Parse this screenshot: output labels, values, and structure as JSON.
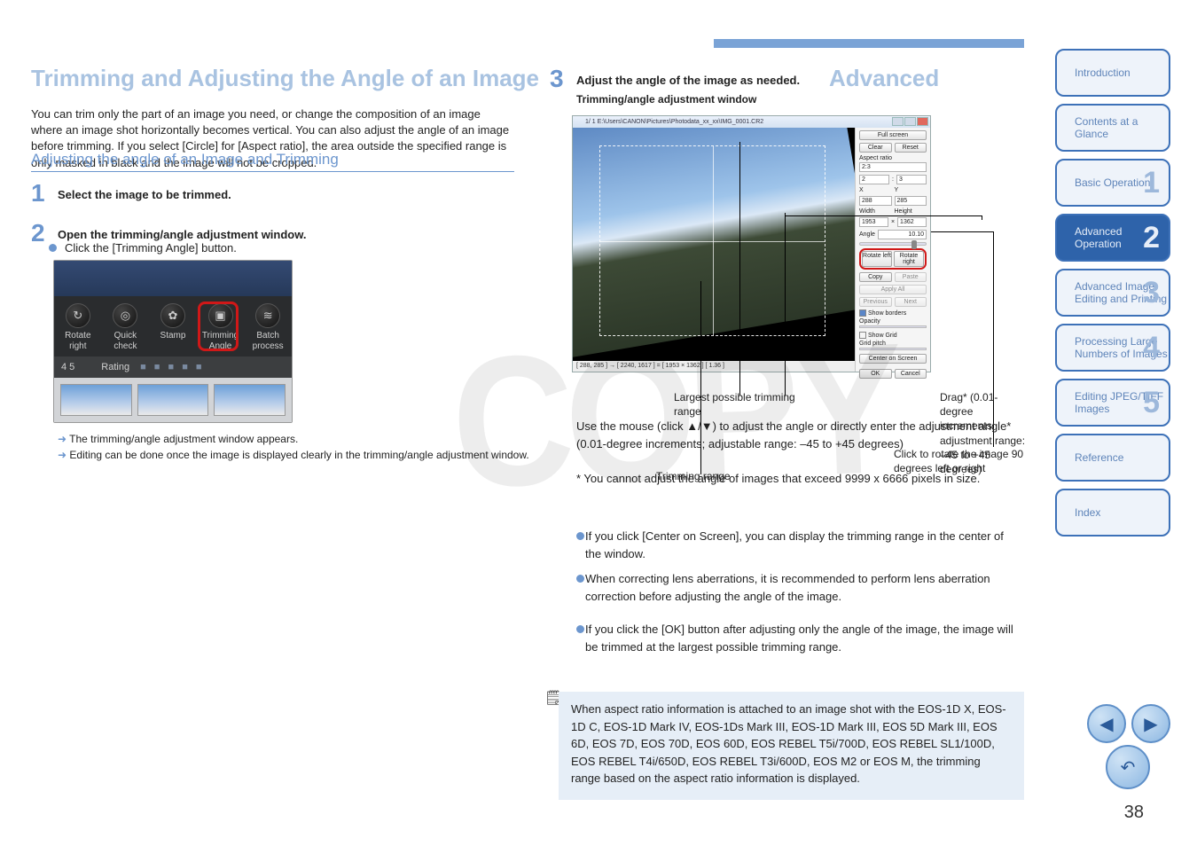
{
  "page": {
    "number": "38",
    "watermark": "COPY",
    "title_main": "Trimming and Adjusting the Angle of an Image",
    "title_sub": "Advanced"
  },
  "top_header": {
    "bar_color": "#7aa3d6"
  },
  "intro": "You can trim only the part of an image you need, or change the composition of an image where an image shot horizontally becomes vertical. You can also adjust the angle of an image before trimming. If you select [Circle] for [Aspect ratio], the area outside the specified range is only masked in black and the image will not be cropped.",
  "section_head": "Adjusting the angle of an Image and Trimming",
  "steps": {
    "s1": {
      "num": "1",
      "text": "Select the image to be trimmed."
    },
    "s2": {
      "num": "2",
      "text": "Open the trimming/angle adjustment window.",
      "bullet": "Click the [Trimming Angle] button."
    },
    "s3": {
      "num": "3",
      "text": "Adjust the angle of the image as needed."
    }
  },
  "toolbar": {
    "buttons": [
      "Rotate right",
      "Quick check",
      "Stamp",
      "Trimming Angle",
      "Batch process"
    ],
    "rating_label": "4 5",
    "rating_text": "Rating"
  },
  "arrows": {
    "a1": "The trimming/angle adjustment window appears.",
    "a2": "Editing can be done once the image is displayed clearly in the trimming/angle adjustment window."
  },
  "app": {
    "title": "1/ 1 E:\\Users\\CANON\\Pictures\\Photodata_xx_xx\\IMG_0001.CR2",
    "status": "[ 288, 285 ] → [ 2240, 1617 ] = [ 1953 × 1362 ] [ 1.36 ]",
    "panel": {
      "full_screen": "Full screen",
      "clear": "Clear",
      "reset": "Reset",
      "aspect_label": "Aspect ratio",
      "aspect_value": "2:3",
      "ratio_a": "2",
      "ratio_b": "3",
      "xy_x": "X",
      "xy_y": "Y",
      "x_val": "288",
      "y_val": "285",
      "w_lbl": "Width",
      "h_lbl": "Height",
      "w_val": "1953",
      "h_val": "1362",
      "angle_lbl": "Angle",
      "angle_val": "10.10",
      "rot_l": "Rotate left",
      "rot_r": "Rotate right",
      "copy": "Copy",
      "paste": "Paste",
      "apply": "Apply All",
      "prev": "Previous",
      "next": "Next",
      "show_borders": "Show borders",
      "opacity": "Opacity",
      "show_grid": "Show Grid",
      "grid_pitch": "Grid pitch",
      "center": "Center on Screen",
      "ok": "OK",
      "cancel": "Cancel"
    }
  },
  "callouts": {
    "window_label": "Trimming/angle adjustment window",
    "possible_range": "Largest possible trimming range",
    "trim_range": "Trimming range",
    "drag_instr": "Drag* (0.01-degree increments; adjustment range: –45 to +45 degrees)",
    "mouse_instr": "Use the mouse (click ▲/▼) to adjust the angle or directly enter the adjustment angle* (0.01-degree increments; adjustable range: –45 to +45 degrees)",
    "click_90": "Click to rotate the image 90 degrees left or right",
    "footnote": "* You cannot adjust the angle of images that exceed 9999 x 6666 pixels in size."
  },
  "bullets": {
    "b1": "If you click [Center on Screen], you can display the trimming range in the center of the window.",
    "b2": "When correcting lens aberrations, it is recommended to perform lens aberration correction before adjusting the angle of the image.",
    "b3": "If you click the [OK] button after adjusting only the angle of the image, the image will be trimmed at the largest possible trimming range."
  },
  "note": "When aspect ratio information is attached to an image shot with the EOS-1D X, EOS-1D C, EOS-1D Mark IV, EOS-1Ds Mark III, EOS-1D Mark III, EOS 5D Mark III, EOS 6D, EOS 7D, EOS 70D, EOS 60D, EOS REBEL T5i/700D, EOS REBEL SL1/100D, EOS REBEL T4i/650D, EOS REBEL T3i/600D, EOS M2 or EOS M, the trimming range based on the aspect ratio information is displayed.",
  "tabs": [
    {
      "lbl": "Introduction",
      "num": ""
    },
    {
      "lbl": "Contents at a Glance",
      "num": ""
    },
    {
      "lbl": "Basic Operation",
      "num": "1"
    },
    {
      "lbl": "Advanced Operation",
      "num": "2",
      "active": true
    },
    {
      "lbl": "Advanced Image Editing and Printing",
      "num": "3"
    },
    {
      "lbl": "Processing Large Numbers of Images",
      "num": "4"
    },
    {
      "lbl": "Editing JPEG/TIFF Images",
      "num": "5"
    },
    {
      "lbl": "Reference",
      "num": ""
    },
    {
      "lbl": "Index",
      "num": ""
    }
  ]
}
